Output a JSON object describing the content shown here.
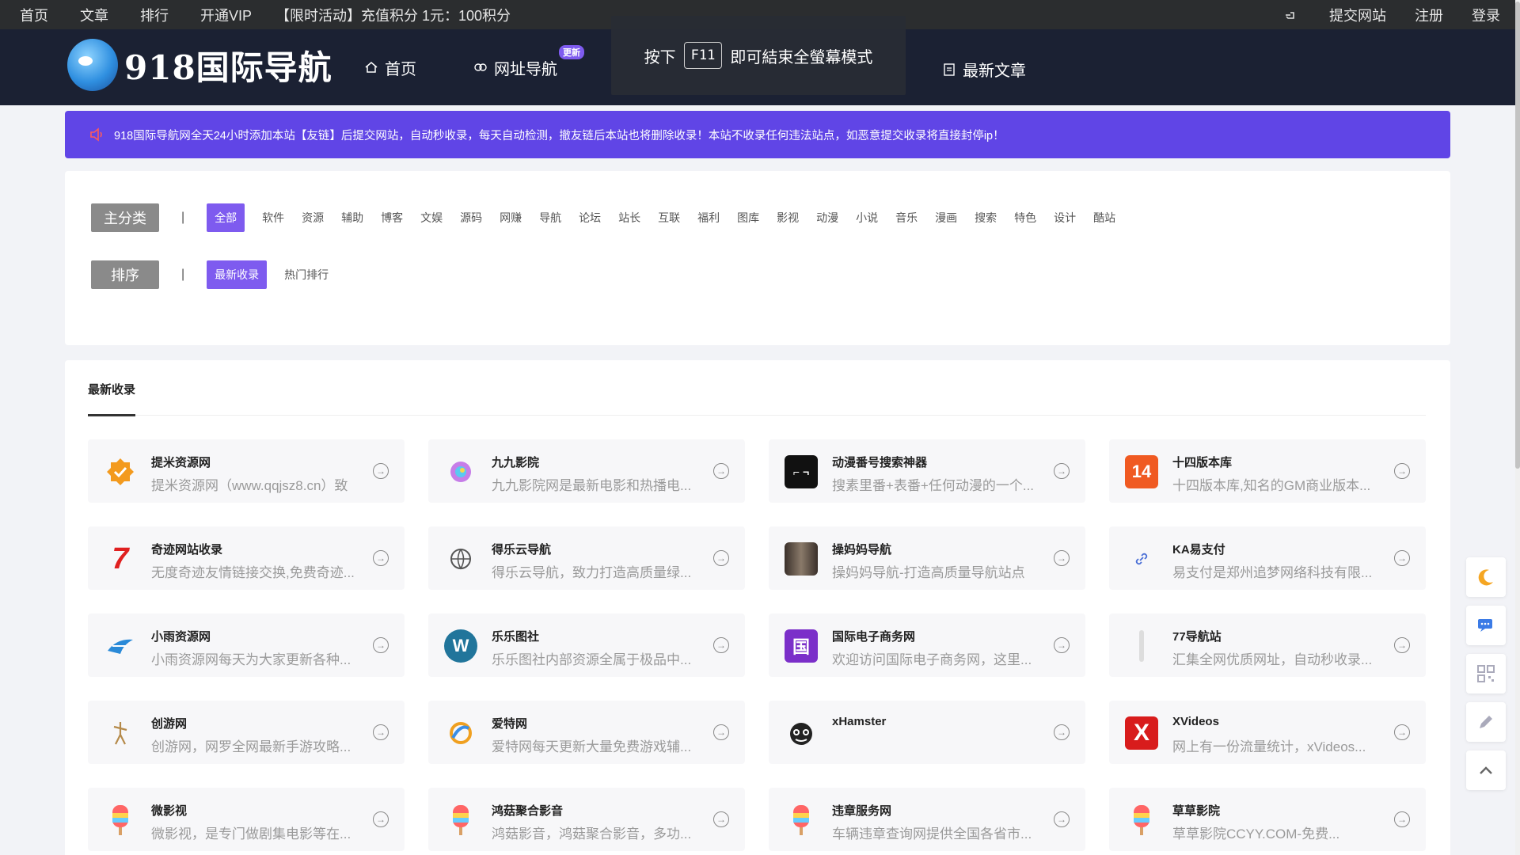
{
  "topbar": {
    "left": [
      "首页",
      "文章",
      "排行",
      "开通VIP"
    ],
    "promo": "【限时活动】充值积分 1元：100积分",
    "right": {
      "submit": "提交网站",
      "register": "注册",
      "login": "登录"
    }
  },
  "nav": {
    "logo_text": "918国际导航",
    "items": {
      "home": "首页",
      "dir": "网址导航",
      "dir_badge": "更新",
      "articles": "最新文章"
    },
    "f11": {
      "before": "按下",
      "key": "F11",
      "after": "即可結束全螢幕模式"
    }
  },
  "notice": "918国际导航网全天24小时添加本站【友链】后提交网站，自动秒收录，每天自动检测，撤友链后本站也将删除收录！本站不收录任何违法站点，如恶意提交收录将直接封停ip！",
  "filter": {
    "main_label": "主分类",
    "categories": [
      "全部",
      "软件",
      "资源",
      "辅助",
      "博客",
      "文娱",
      "源码",
      "网赚",
      "导航",
      "论坛",
      "站长",
      "互联",
      "福利",
      "图库",
      "影视",
      "动漫",
      "小说",
      "音乐",
      "漫画",
      "搜索",
      "特色",
      "设计",
      "酷站"
    ],
    "sort_label": "排序",
    "sorts": [
      "最新收录",
      "热门排行"
    ]
  },
  "listing": {
    "title": "最新收录",
    "sites": [
      {
        "name": "提米资源网",
        "desc": "提米资源网（www.qqjsz8.cn）致",
        "icon": "check-badge-icon",
        "color": "#f39a1e"
      },
      {
        "name": "九九影院",
        "desc": "九九影院网是最新电影和热播电...",
        "icon": "swirl-icon",
        "color": "#c67de8"
      },
      {
        "name": "动漫番号搜索神器",
        "desc": "搜素里番+表番+任何动漫的一个...",
        "icon": "app-black-icon",
        "color": "#111111"
      },
      {
        "name": "十四版本库",
        "desc": "十四版本库,知名的GM商业版本...",
        "icon": "num14-icon",
        "color": "#f05a22"
      },
      {
        "name": "奇迹网站收录",
        "desc": "无度奇迹友情链接交换,免费奇迹...",
        "icon": "seven-icon",
        "color": "#e02020"
      },
      {
        "name": "得乐云导航",
        "desc": "得乐云导航，致力打造高质量绿...",
        "icon": "globe-icon",
        "color": "#555555"
      },
      {
        "name": "操妈妈导航",
        "desc": "操妈妈导航-打造高质量导航站点",
        "icon": "photo-icon",
        "color": "#5a4a40"
      },
      {
        "name": "KA易支付",
        "desc": "易支付是郑州追梦网络科技有限...",
        "icon": "link-icon",
        "color": "#4a6fd6"
      },
      {
        "name": "小雨资源网",
        "desc": "小雨资源网每天为大家更新各种...",
        "icon": "bird-icon",
        "color": "#2a8ad8"
      },
      {
        "name": "乐乐图社",
        "desc": "乐乐图社内部资源全属于极品中...",
        "icon": "wordpress-icon",
        "color": "#21759b"
      },
      {
        "name": "国际电子商务网",
        "desc": "欢迎访问国际电子商务网，这里...",
        "icon": "guo-icon",
        "color": "#7b2fc9"
      },
      {
        "name": "77导航站",
        "desc": "汇集全网优质网址，自动秒收录...",
        "icon": "bar-icon",
        "color": "#cccccc"
      },
      {
        "name": "创游网",
        "desc": "创游网，网罗全网最新手游攻略...",
        "icon": "figure-icon",
        "color": "#b58a4a"
      },
      {
        "name": "爱特网",
        "desc": "爱特网每天更新大量免费游戏辅...",
        "icon": "ring-icon",
        "color": "#f0a020"
      },
      {
        "name": "xHamster",
        "desc": "",
        "icon": "raccoon-icon",
        "color": "#222222"
      },
      {
        "name": "XVideos",
        "desc": "网上有一份流量统计，xVideos...",
        "icon": "x-icon",
        "color": "#d81c1c"
      },
      {
        "name": "微影视",
        "desc": "微影视，是专门做剧集电影等在...",
        "icon": "popsicle-icon",
        "color": "#f06a5a"
      },
      {
        "name": "鸿菇聚合影音",
        "desc": "鸿菇影音，鸿菇聚合影音，多功...",
        "icon": "popsicle-icon",
        "color": "#f06a5a"
      },
      {
        "name": "违章服务网",
        "desc": "车辆违章查询网提供全国各省市...",
        "icon": "popsicle-icon",
        "color": "#f06a5a"
      },
      {
        "name": "草草影院",
        "desc": "草草影院CCYY.COM-免费...",
        "icon": "popsicle-icon",
        "color": "#f06a5a"
      }
    ]
  },
  "float_tools": [
    "moon-icon",
    "chat-icon",
    "qrcode-icon",
    "edit-icon",
    "back-to-top-icon"
  ],
  "colors": {
    "accent": "#7e5bef",
    "notice": "#6045e6",
    "nav": "#1b2133",
    "topbar": "#2b2d2f"
  }
}
